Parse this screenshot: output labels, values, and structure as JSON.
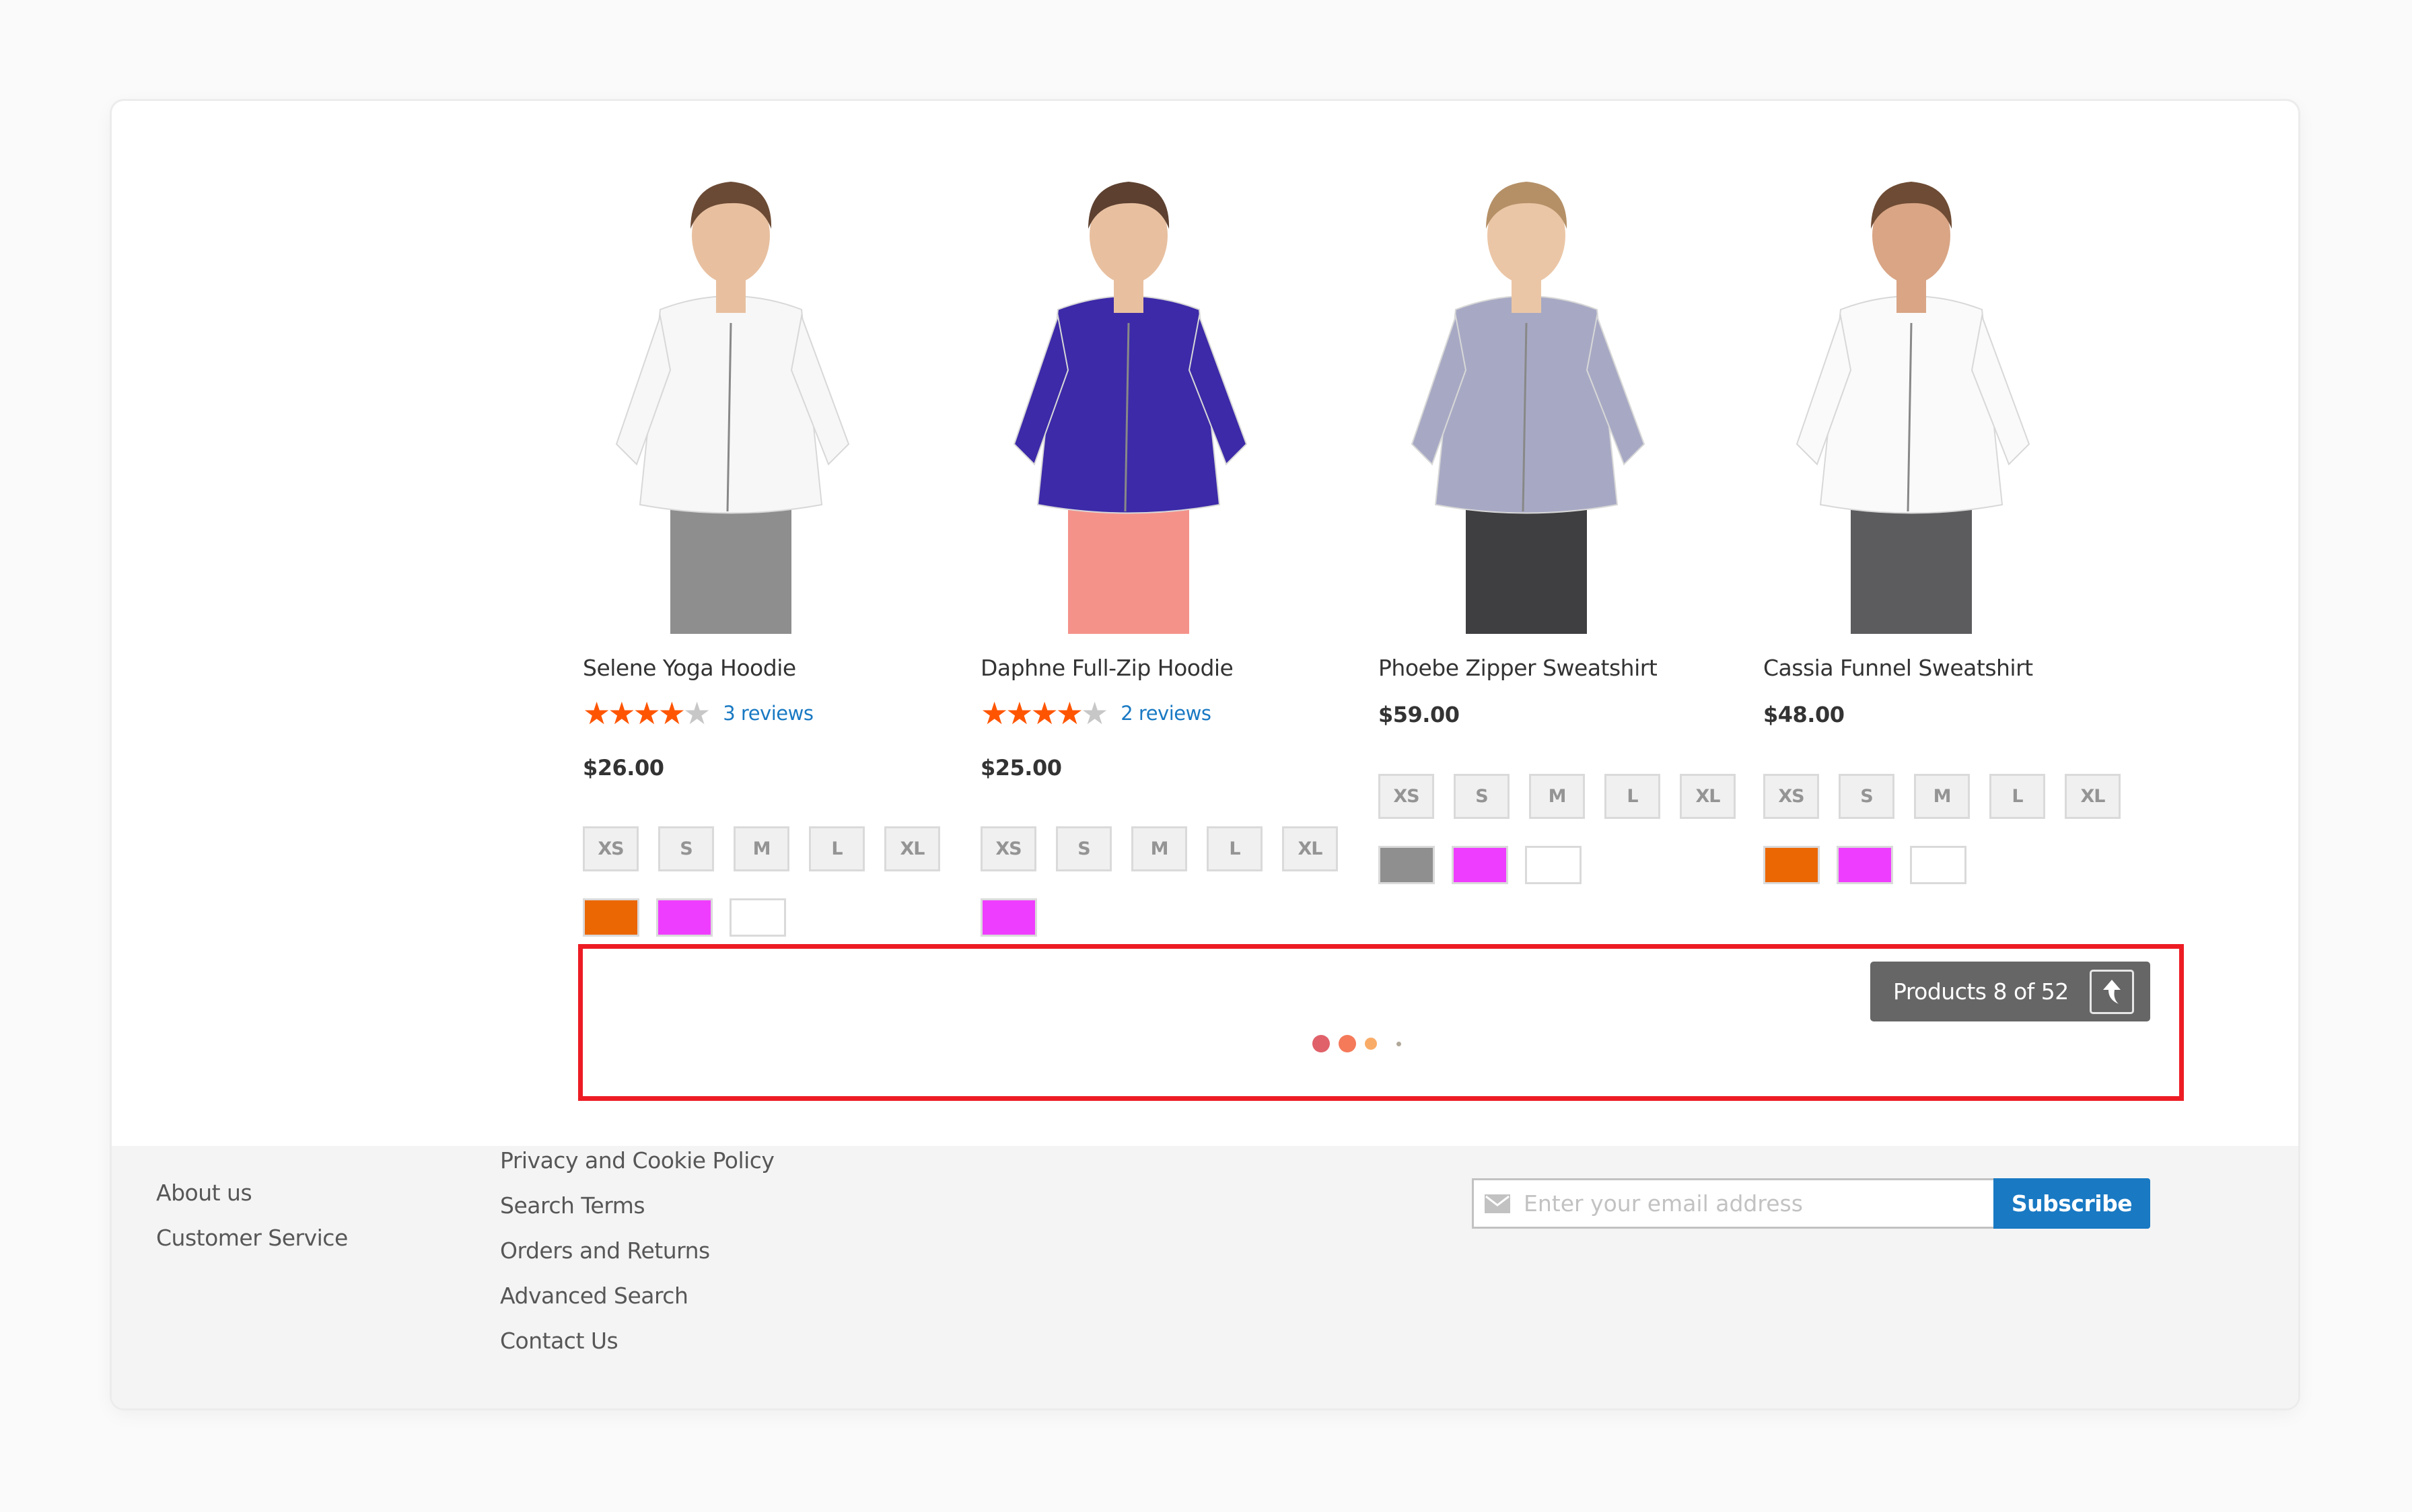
{
  "products": [
    {
      "name": "Selene Yoga Hoodie",
      "rating": 4,
      "rating_max": 5,
      "reviews_label": "3 reviews",
      "price": "$26.00",
      "sizes": [
        "XS",
        "S",
        "M",
        "L",
        "XL"
      ],
      "colors": [
        "#eb6703",
        "#ef3dff",
        "#ffffff"
      ],
      "image_icon": "product-photo-white-hoodie",
      "image_colors": {
        "top": "#f7f7f7",
        "pants": "#8e8e8e",
        "hair": "#6b4a35",
        "skin": "#e8c0a0"
      }
    },
    {
      "name": "Daphne Full-Zip Hoodie",
      "rating": 4,
      "rating_max": 5,
      "reviews_label": "2 reviews",
      "price": "$25.00",
      "sizes": [
        "XS",
        "S",
        "M",
        "L",
        "XL"
      ],
      "colors": [
        "#ef3dff"
      ],
      "image_icon": "product-photo-purple-hoodie",
      "image_colors": {
        "top": "#3c2aa8",
        "pants": "#f4928a",
        "hair": "#5d4030",
        "skin": "#e8c0a0"
      }
    },
    {
      "name": "Phoebe Zipper Sweatshirt",
      "rating": null,
      "reviews_label": null,
      "price": "$59.00",
      "sizes": [
        "XS",
        "S",
        "M",
        "L",
        "XL"
      ],
      "colors": [
        "#8f8f8f",
        "#ef3dff",
        "#ffffff"
      ],
      "image_icon": "product-photo-grey-sweatshirt",
      "image_colors": {
        "top": "#a7a9c4",
        "pants": "#3f3f42",
        "hair": "#b59067",
        "skin": "#ebc6a6"
      }
    },
    {
      "name": "Cassia Funnel Sweatshirt",
      "rating": null,
      "reviews_label": null,
      "price": "$48.00",
      "sizes": [
        "XS",
        "S",
        "M",
        "L",
        "XL"
      ],
      "colors": [
        "#eb6703",
        "#ef3dff",
        "#ffffff"
      ],
      "image_icon": "product-photo-white-funnel-sweatshirt",
      "image_colors": {
        "top": "#fafafa",
        "pants": "#5c5c5f",
        "hair": "#6e4b34",
        "skin": "#d9a585"
      }
    }
  ],
  "pager": {
    "counter_label": "Products 8 of 52",
    "back_to_top_icon": "arrow-up-icon",
    "loader_dot_colors": [
      "#e0616a",
      "#f47a5a",
      "#f9ac68",
      "#b0a898"
    ]
  },
  "highlight_color": "#ed1c24",
  "footer": {
    "col1": [
      "About us",
      "Customer Service"
    ],
    "col2": [
      "Privacy and Cookie Policy",
      "Search Terms",
      "Orders and Returns",
      "Advanced Search",
      "Contact Us"
    ],
    "newsletter": {
      "placeholder": "Enter your email address",
      "value": "",
      "button_label": "Subscribe",
      "icon": "envelope-icon"
    }
  }
}
